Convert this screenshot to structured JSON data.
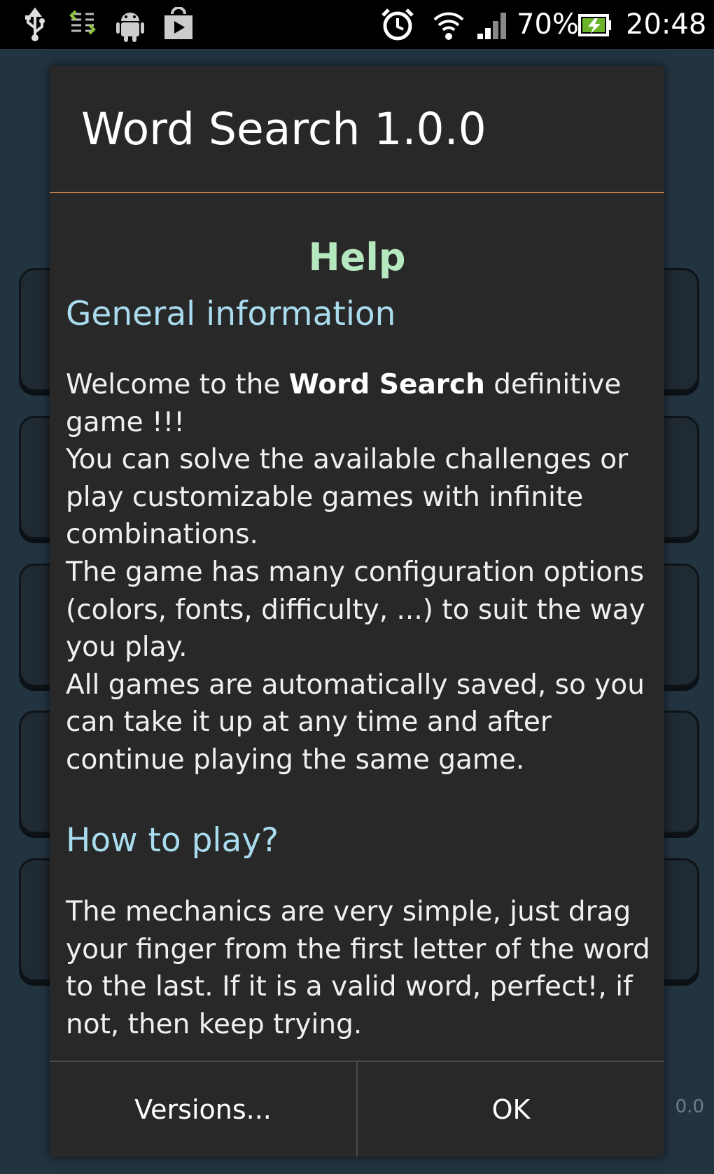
{
  "status_bar": {
    "battery_percent": "70%",
    "time": "20:48"
  },
  "background": {
    "version_fragment": "0.0"
  },
  "dialog": {
    "title": "Word Search 1.0.0",
    "help_heading": "Help",
    "sections": [
      {
        "heading": "General information",
        "paragraph_lines": [
          "Welcome to the",
          "Word Search",
          "definitive game !!!",
          "You can solve the available challenges or play customizable games with infinite combinations.",
          "The game has many configuration options (colors, fonts, difficulty, ...) to suit the way you play.",
          "All games are automatically saved, so you can take it up at any time and after continue playing the same game."
        ]
      },
      {
        "heading": "How to play?",
        "paragraph": "The mechanics are very simple, just drag your finger from the first letter of the word to the last. If it is a valid word, perfect!, if not, then keep trying."
      }
    ],
    "buttons": {
      "versions": "Versions...",
      "ok": "OK"
    }
  },
  "colors": {
    "title_divider": "#b57c4e",
    "help_heading": "#b6e8bf",
    "section_heading": "#a9dcee",
    "dialog_bg": "#282828"
  }
}
